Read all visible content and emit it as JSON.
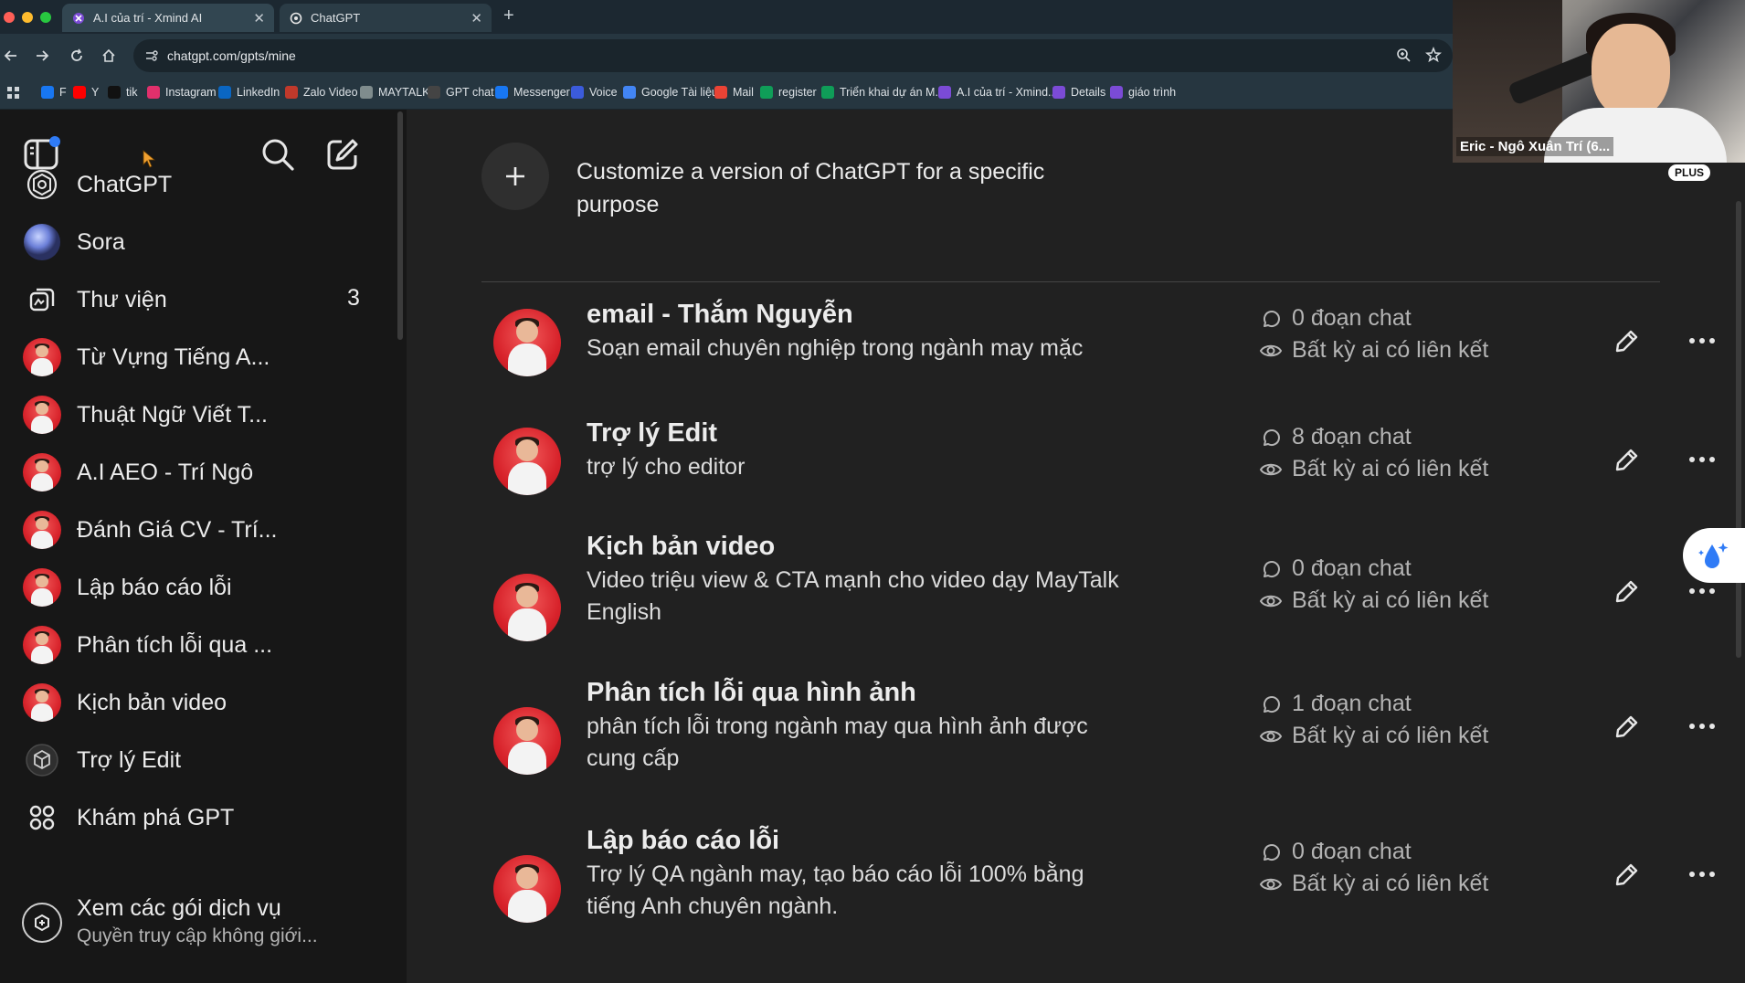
{
  "browser": {
    "tabs": [
      {
        "label": "A.I của trí - Xmind AI",
        "active": false
      },
      {
        "label": "ChatGPT",
        "active": true
      }
    ],
    "url": "chatgpt.com/gpts/mine",
    "bookmarks": [
      {
        "label": "F",
        "icon": "facebook-icon",
        "color": "#1877f2"
      },
      {
        "label": "Y",
        "icon": "youtube-icon",
        "color": "#ff0000"
      },
      {
        "label": "tik",
        "icon": "tiktok-icon",
        "color": "#111111"
      },
      {
        "label": "Instagram",
        "icon": "instagram-icon",
        "color": "#e1306c"
      },
      {
        "label": "LinkedIn",
        "icon": "linkedin-icon",
        "color": "#0a66c2"
      },
      {
        "label": "Zalo Video",
        "icon": "zalo-icon",
        "color": "#c0392b"
      },
      {
        "label": "MAYTALK",
        "icon": "maytalk-icon",
        "color": "#7f8c8d"
      },
      {
        "label": "GPT chat",
        "icon": "openai-icon",
        "color": "#444444"
      },
      {
        "label": "Messenger",
        "icon": "messenger-icon",
        "color": "#1877f2"
      },
      {
        "label": "Voice",
        "icon": "voice-icon",
        "color": "#3b5bdb"
      },
      {
        "label": "Google Tài liệu",
        "icon": "google-docs-icon",
        "color": "#4285f4"
      },
      {
        "label": "Mail",
        "icon": "gmail-icon",
        "color": "#ea4335"
      },
      {
        "label": "register",
        "icon": "sheets-icon",
        "color": "#0f9d58"
      },
      {
        "label": "Triển khai dự án M...",
        "icon": "sheets-icon",
        "color": "#0f9d58"
      },
      {
        "label": "A.I của trí - Xmind...",
        "icon": "xmind-icon",
        "color": "#7b4bd6"
      },
      {
        "label": "Details",
        "icon": "xmind-icon",
        "color": "#7b4bd6"
      },
      {
        "label": "giáo trình",
        "icon": "xmind-icon",
        "color": "#7b4bd6"
      }
    ]
  },
  "sidebar": {
    "items": [
      {
        "label": "ChatGPT",
        "icon": "openai-logo-icon"
      },
      {
        "label": "Sora",
        "icon": "sora-icon"
      },
      {
        "label": "Thư viện",
        "icon": "library-icon",
        "count": "3"
      },
      {
        "label": "Từ Vựng Tiếng A...",
        "icon": "gpt-avatar"
      },
      {
        "label": "Thuật Ngữ Viết T...",
        "icon": "gpt-avatar"
      },
      {
        "label": "A.I AEO - Trí Ngô",
        "icon": "gpt-avatar"
      },
      {
        "label": "Đánh Giá CV - Trí...",
        "icon": "gpt-avatar"
      },
      {
        "label": "Lập báo cáo lỗi",
        "icon": "gpt-avatar"
      },
      {
        "label": "Phân tích lỗi qua ...",
        "icon": "gpt-avatar"
      },
      {
        "label": "Kịch bản video",
        "icon": "gpt-avatar"
      },
      {
        "label": "Trợ lý Edit",
        "icon": "cube-icon"
      },
      {
        "label": "Khám phá GPT",
        "icon": "grid-icon"
      }
    ],
    "upgrade": {
      "title": "Xem các gói dịch vụ",
      "subtitle": "Quyền truy cập không giới..."
    }
  },
  "main": {
    "create": {
      "text": "Customize a version of ChatGPT for a specific purpose"
    },
    "gpts": [
      {
        "title": "email - Thắm Nguyễn",
        "description": "Soạn email chuyên nghiệp trong ngành may mặc",
        "chats": "0 đoạn chat",
        "visibility": "Bất kỳ ai có liên kết"
      },
      {
        "title": "Trợ lý Edit",
        "description": "trợ lý cho editor",
        "chats": "8 đoạn chat",
        "visibility": "Bất kỳ ai có liên kết"
      },
      {
        "title": "Kịch bản video",
        "description": "Video triệu view & CTA mạnh cho video dạy MayTalk English",
        "chats": "0 đoạn chat",
        "visibility": "Bất kỳ ai có liên kết"
      },
      {
        "title": "Phân tích lỗi qua hình ảnh",
        "description": "phân tích lỗi trong ngành may qua hình ảnh được cung cấp",
        "chats": "1 đoạn chat",
        "visibility": "Bất kỳ ai có liên kết"
      },
      {
        "title": "Lập báo cáo lỗi",
        "description": "Trợ lý QA ngành may, tạo báo cáo lỗi 100% bằng tiếng Anh chuyên ngành.",
        "chats": "0 đoạn chat",
        "visibility": "Bất kỳ ai có liên kết"
      }
    ]
  },
  "webcam": {
    "name": "Eric - Ngô Xuân Trí (6...",
    "badge": "PLUS"
  },
  "colors": {
    "sidebar_bg": "#171717",
    "main_bg": "#212121",
    "browser_tabstrip": "#1c2831",
    "browser_toolbar": "#263640"
  }
}
